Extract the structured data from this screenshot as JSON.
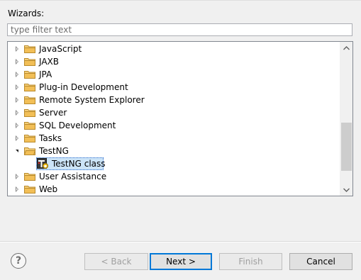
{
  "wizards_label": "Wizards:",
  "filter": {
    "value": "",
    "placeholder": "type filter text"
  },
  "tree": {
    "items": [
      {
        "label": "JavaScript",
        "expanded": false,
        "icon": "folder-icon"
      },
      {
        "label": "JAXB",
        "expanded": false,
        "icon": "folder-icon"
      },
      {
        "label": "JPA",
        "expanded": false,
        "icon": "folder-icon"
      },
      {
        "label": "Plug-in Development",
        "expanded": false,
        "icon": "folder-icon"
      },
      {
        "label": "Remote System Explorer",
        "expanded": false,
        "icon": "folder-icon"
      },
      {
        "label": "Server",
        "expanded": false,
        "icon": "folder-icon"
      },
      {
        "label": "SQL Development",
        "expanded": false,
        "icon": "folder-icon"
      },
      {
        "label": "Tasks",
        "expanded": false,
        "icon": "folder-icon"
      },
      {
        "label": "TestNG",
        "expanded": true,
        "icon": "folder-icon"
      },
      {
        "label": "TestNG class",
        "child": true,
        "selected": true,
        "icon": "testng-class-icon"
      },
      {
        "label": "User Assistance",
        "expanded": false,
        "icon": "folder-icon"
      },
      {
        "label": "Web",
        "expanded": false,
        "icon": "folder-icon"
      }
    ]
  },
  "buttons": {
    "help": "?",
    "back": "< Back",
    "next": "Next >",
    "finish": "Finish",
    "cancel": "Cancel"
  },
  "colors": {
    "selection": "#cce4f7",
    "default_button_border": "#0078d7",
    "folder": "#e8b448"
  }
}
